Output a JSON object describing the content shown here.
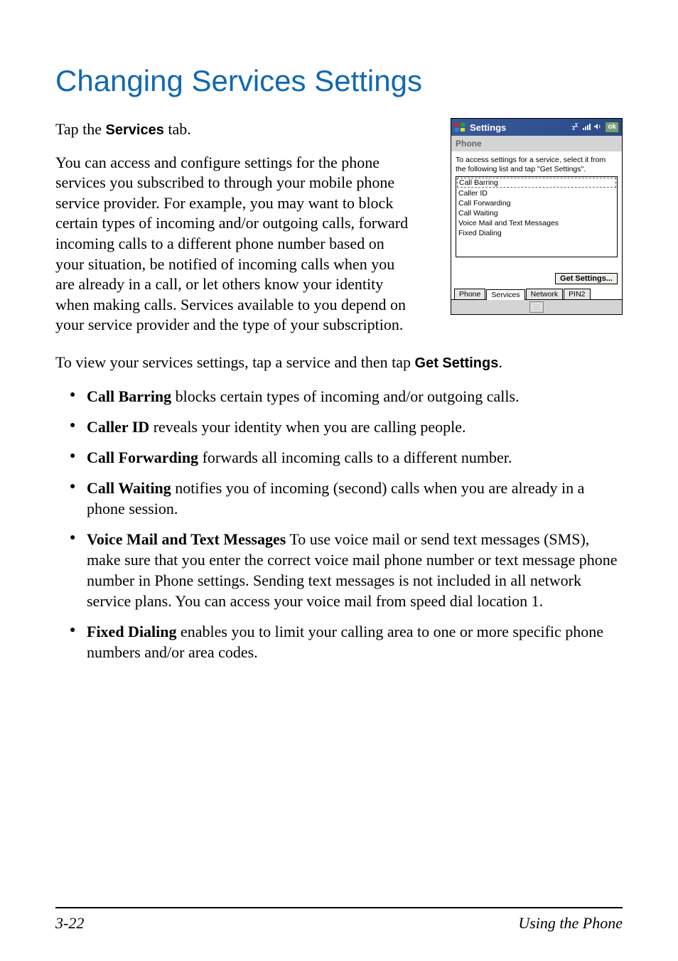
{
  "heading": "Changing Services Settings",
  "intro": {
    "p1_a": "Tap the ",
    "p1_bold": "Services",
    "p1_b": " tab.",
    "p2": "You can access and configure settings for the phone services you subscribed to through your mobile phone service provider. For example, you may want to block certain types of incoming and/or outgoing calls, forward incoming calls to a different phone number based on your situation, be notified of incoming calls when you are already in a call, or let others know your identity when making calls. Services available to you depend on your service provider and the type of your subscription."
  },
  "sentence": {
    "a": "To view your services settings, tap a service and then tap ",
    "bold": "Get Settings",
    "b": "."
  },
  "bullets": [
    {
      "term": "Call Barring",
      "rest": "  blocks certain types of incoming and/or outgoing calls."
    },
    {
      "term": "Caller ID",
      "rest": "  reveals your identity when you are calling people."
    },
    {
      "term": "Call Forwarding",
      "rest": "  forwards all incoming calls to a different number."
    },
    {
      "term": "Call Waiting",
      "rest": "  notifies you of incoming (second) calls when you are already in a phone session."
    },
    {
      "term": "Voice Mail and Text Messages",
      "rest": "  To use voice mail or send text messages (SMS), make sure that you enter the correct voice mail phone number or text message phone number in Phone settings. Sending text messages is not included in all network service plans. You can access your voice mail from speed dial location 1."
    },
    {
      "term": "Fixed Dialing",
      "rest": "  enables you to limit your calling area to one or more specific phone numbers and/or area codes."
    }
  ],
  "screenshot": {
    "title": "Settings",
    "ok": "ok",
    "subheader": "Phone",
    "instruction": "To access settings for a service, select it from the following list and tap \"Get Settings\".",
    "list": [
      "Call Barring",
      "Caller ID",
      "Call Forwarding",
      "Call Waiting",
      "Voice Mail and Text Messages",
      "Fixed Dialing"
    ],
    "button": "Get Settings...",
    "tabs": [
      "Phone",
      "Services",
      "Network",
      "PIN2"
    ],
    "active_tab_index": 1
  },
  "footer": {
    "left": "3-22",
    "right": "Using the Phone"
  }
}
